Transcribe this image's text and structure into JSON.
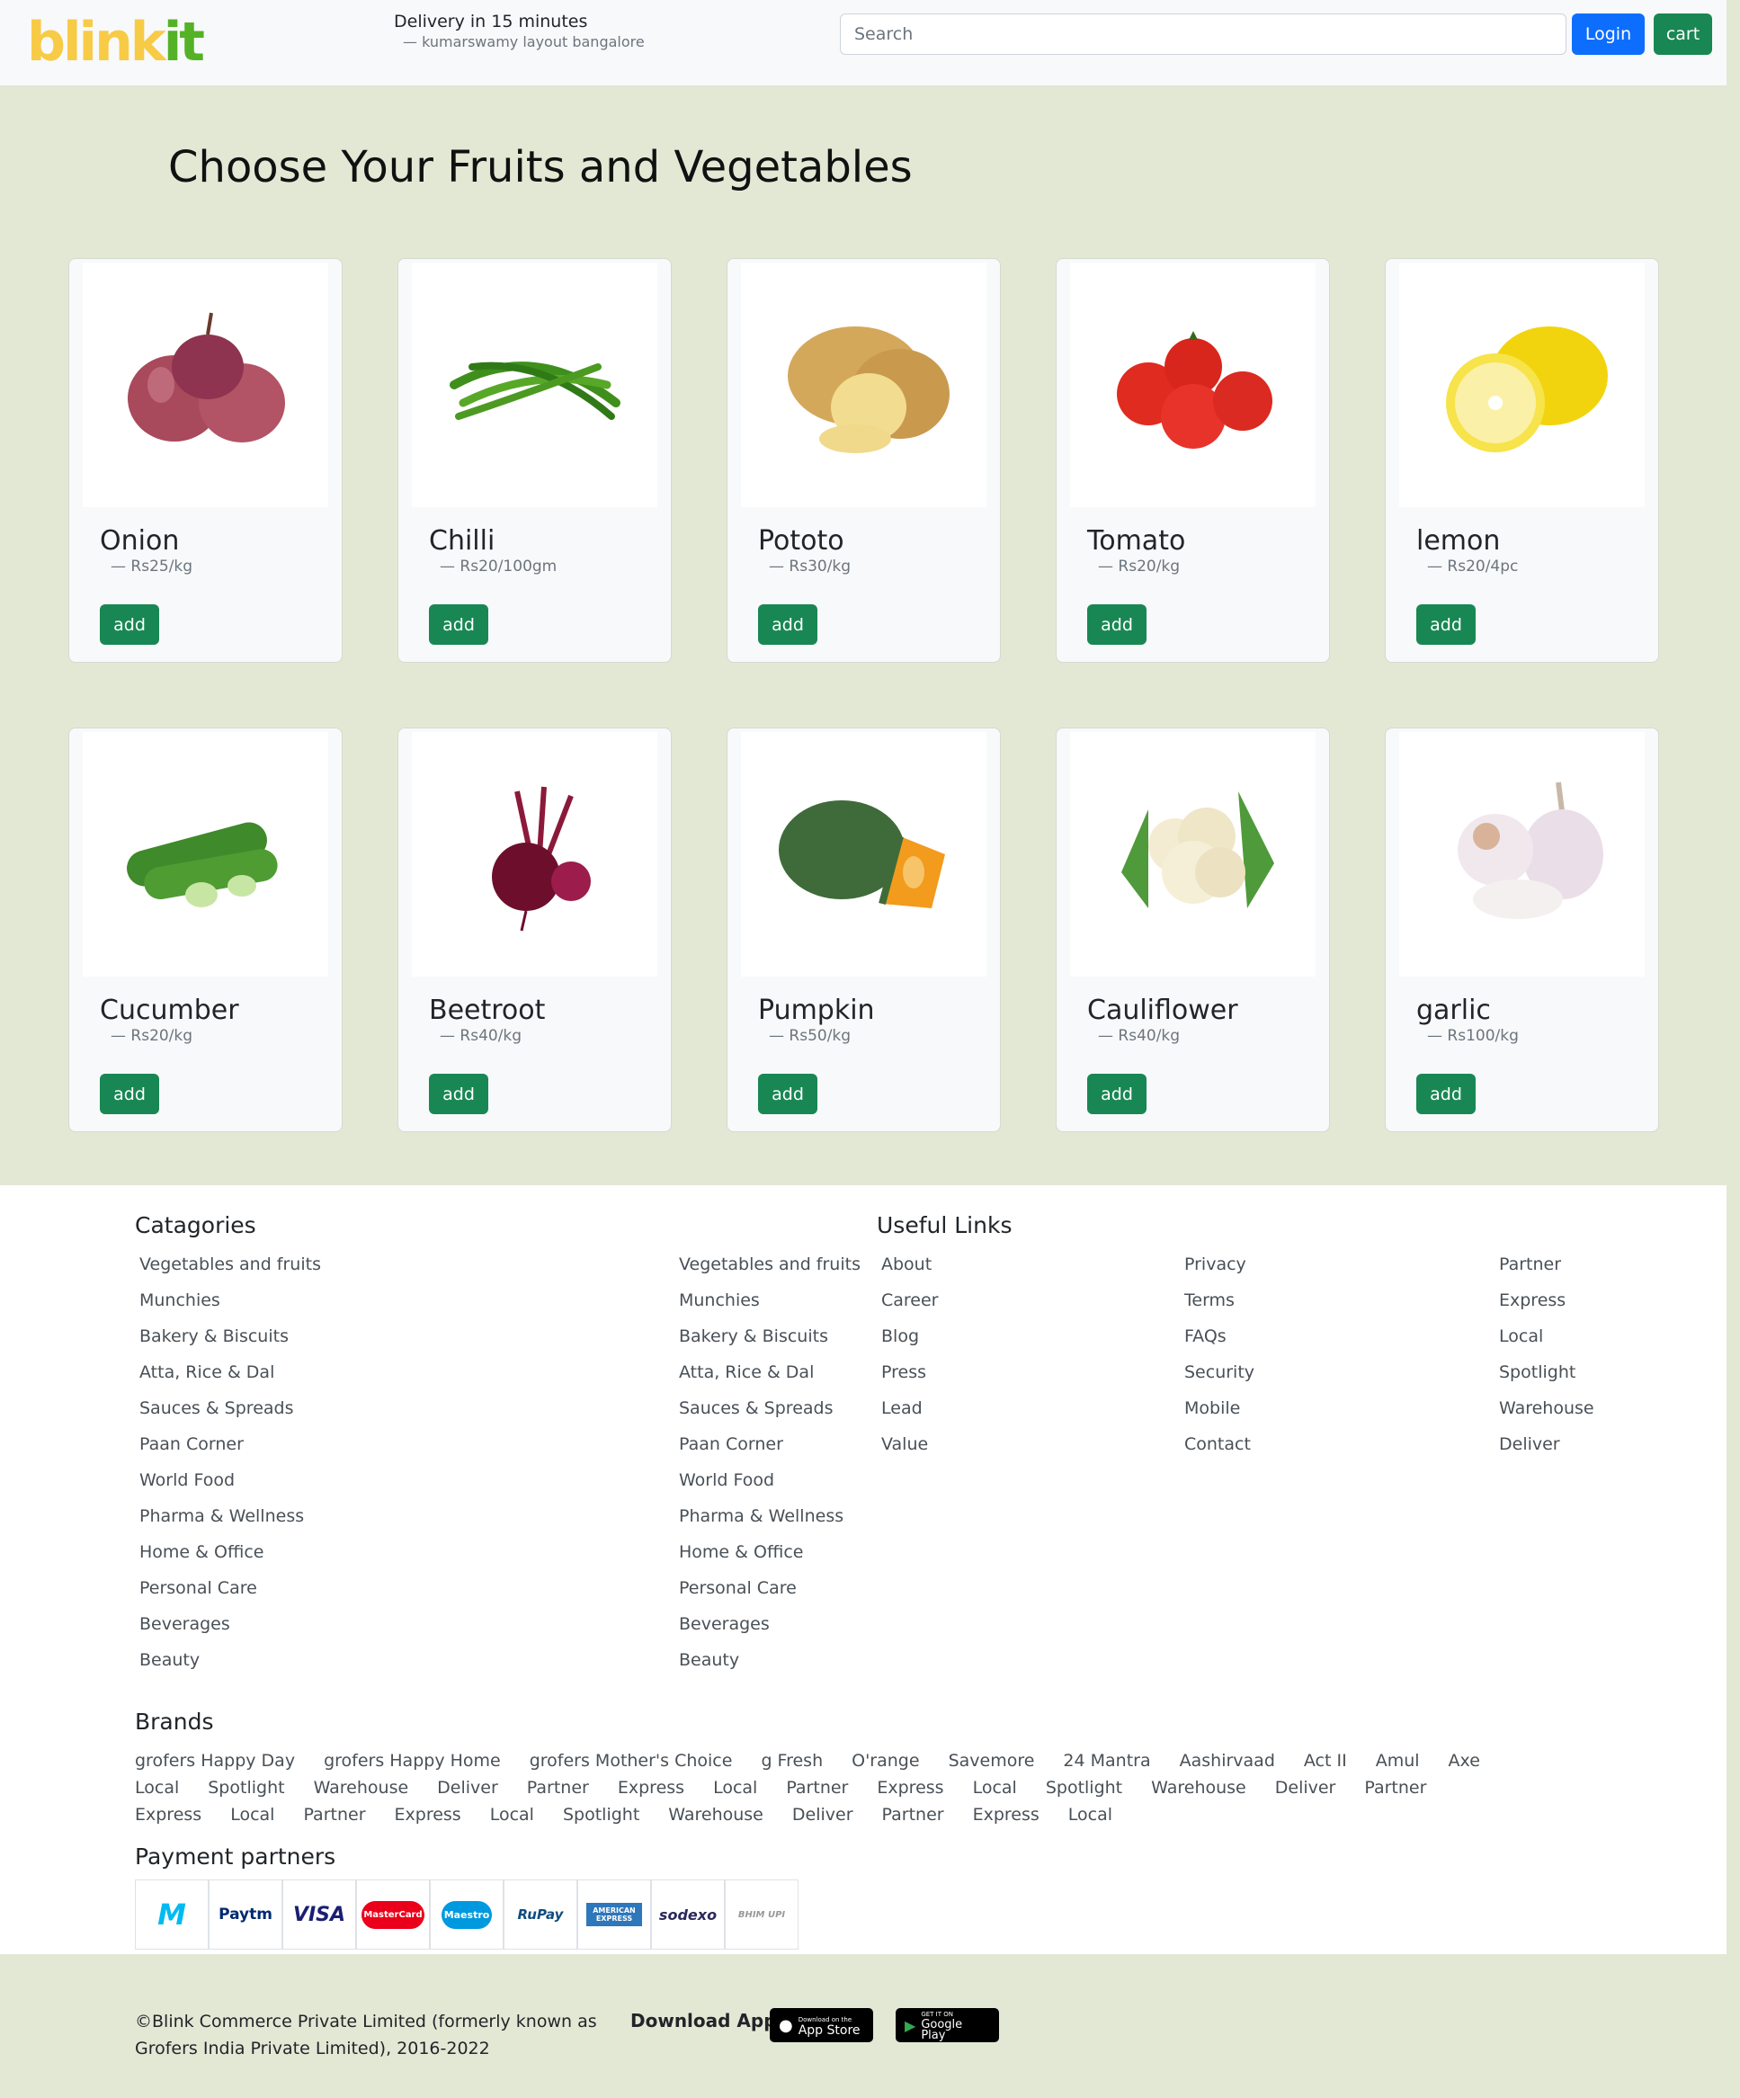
{
  "header": {
    "logo_part1": "blink",
    "logo_part2": "it",
    "delivery_title": "Delivery in 15 minutes",
    "delivery_location": "— kumarswamy layout bangalore",
    "search_placeholder": "Search",
    "login_label": "Login",
    "cart_label": "cart"
  },
  "page_title": "Choose Your Fruits and Vegetables",
  "products": [
    {
      "name": "Onion",
      "price": "— Rs25/kg",
      "add": "add",
      "icon": "onion-image"
    },
    {
      "name": "Chilli",
      "price": "— Rs20/100gm",
      "add": "add",
      "icon": "chilli-image"
    },
    {
      "name": "Pototo",
      "price": "— Rs30/kg",
      "add": "add",
      "icon": "potato-image"
    },
    {
      "name": "Tomato",
      "price": "— Rs20/kg",
      "add": "add",
      "icon": "tomato-image"
    },
    {
      "name": "lemon",
      "price": "— Rs20/4pc",
      "add": "add",
      "icon": "lemon-image"
    },
    {
      "name": "Cucumber",
      "price": "— Rs20/kg",
      "add": "add",
      "icon": "cucumber-image"
    },
    {
      "name": "Beetroot",
      "price": "— Rs40/kg",
      "add": "add",
      "icon": "beetroot-image"
    },
    {
      "name": "Pumpkin",
      "price": "— Rs50/kg",
      "add": "add",
      "icon": "pumpkin-image"
    },
    {
      "name": "Cauliflower",
      "price": "— Rs40/kg",
      "add": "add",
      "icon": "cauliflower-image"
    },
    {
      "name": "garlic",
      "price": "— Rs100/kg",
      "add": "add",
      "icon": "garlic-image"
    }
  ],
  "footer": {
    "categories_heading": "Catagories",
    "useful_links_heading": "Useful Links",
    "categories_col1": [
      "Vegetables and fruits",
      "Munchies",
      "Bakery & Biscuits",
      "Atta, Rice & Dal",
      "Sauces & Spreads",
      "Paan Corner",
      "World Food",
      "Pharma & Wellness",
      "Home & Office",
      "Personal Care",
      "Beverages",
      "Beauty"
    ],
    "categories_col2": [
      "Vegetables and fruits",
      "Munchies",
      "Bakery & Biscuits",
      "Atta, Rice & Dal",
      "Sauces & Spreads",
      "Paan Corner",
      "World Food",
      "Pharma & Wellness",
      "Home & Office",
      "Personal Care",
      "Beverages",
      "Beauty"
    ],
    "links_col1": [
      "About",
      "Career",
      "Blog",
      "Press",
      "Lead",
      "Value"
    ],
    "links_col2": [
      "Privacy",
      "Terms",
      "FAQs",
      "Security",
      "Mobile",
      "Contact"
    ],
    "links_col3": [
      "Partner",
      "Express",
      "Local",
      "Spotlight",
      "Warehouse",
      "Deliver"
    ],
    "brands_heading": "Brands",
    "brands": [
      "grofers Happy Day",
      "grofers Happy Home",
      "grofers Mother's Choice",
      "g Fresh",
      "O'range",
      "Savemore",
      "24 Mantra",
      "Aashirvaad",
      "Act II",
      "Amul",
      "Axe",
      "Local",
      "Spotlight",
      "Warehouse",
      "Deliver",
      "Partner",
      "Express",
      "Local",
      "Partner",
      "Express",
      "Local",
      "Spotlight",
      "Warehouse",
      "Deliver",
      "Partner",
      "Express",
      "Local",
      "Partner",
      "Express",
      "Local",
      "Spotlight",
      "Warehouse",
      "Deliver",
      "Partner",
      "Express",
      "Local"
    ],
    "payment_heading": "Payment partners",
    "payments": [
      {
        "label": "M",
        "color": "#00baf2",
        "icon": "mobikwik-logo"
      },
      {
        "label": "Paytm",
        "color": "#002970",
        "icon": "paytm-logo"
      },
      {
        "label": "VISA",
        "color": "#1a1f71",
        "icon": "visa-logo"
      },
      {
        "label": "MasterCard",
        "color": "#eb001b",
        "icon": "mastercard-logo"
      },
      {
        "label": "Maestro",
        "color": "#0099df",
        "icon": "maestro-logo"
      },
      {
        "label": "RuPay",
        "color": "#0f4c81",
        "icon": "rupay-logo"
      },
      {
        "label": "AMERICAN EXPRESS",
        "color": "#2e77bb",
        "icon": "amex-logo"
      },
      {
        "label": "sodexo",
        "color": "#2a295c",
        "icon": "sodexo-logo"
      },
      {
        "label": "BHIM UPI",
        "color": "#777777",
        "icon": "bhim-upi-logo"
      }
    ]
  },
  "bottom": {
    "copyright": "©Blink Commerce Private Limited (formerly known as Grofers India Private Limited), 2016-2022",
    "download_label": "Download App",
    "app_store_small": "Download on the",
    "app_store": "App Store",
    "google_play_small": "GET IT ON",
    "google_play": "Google Play"
  }
}
